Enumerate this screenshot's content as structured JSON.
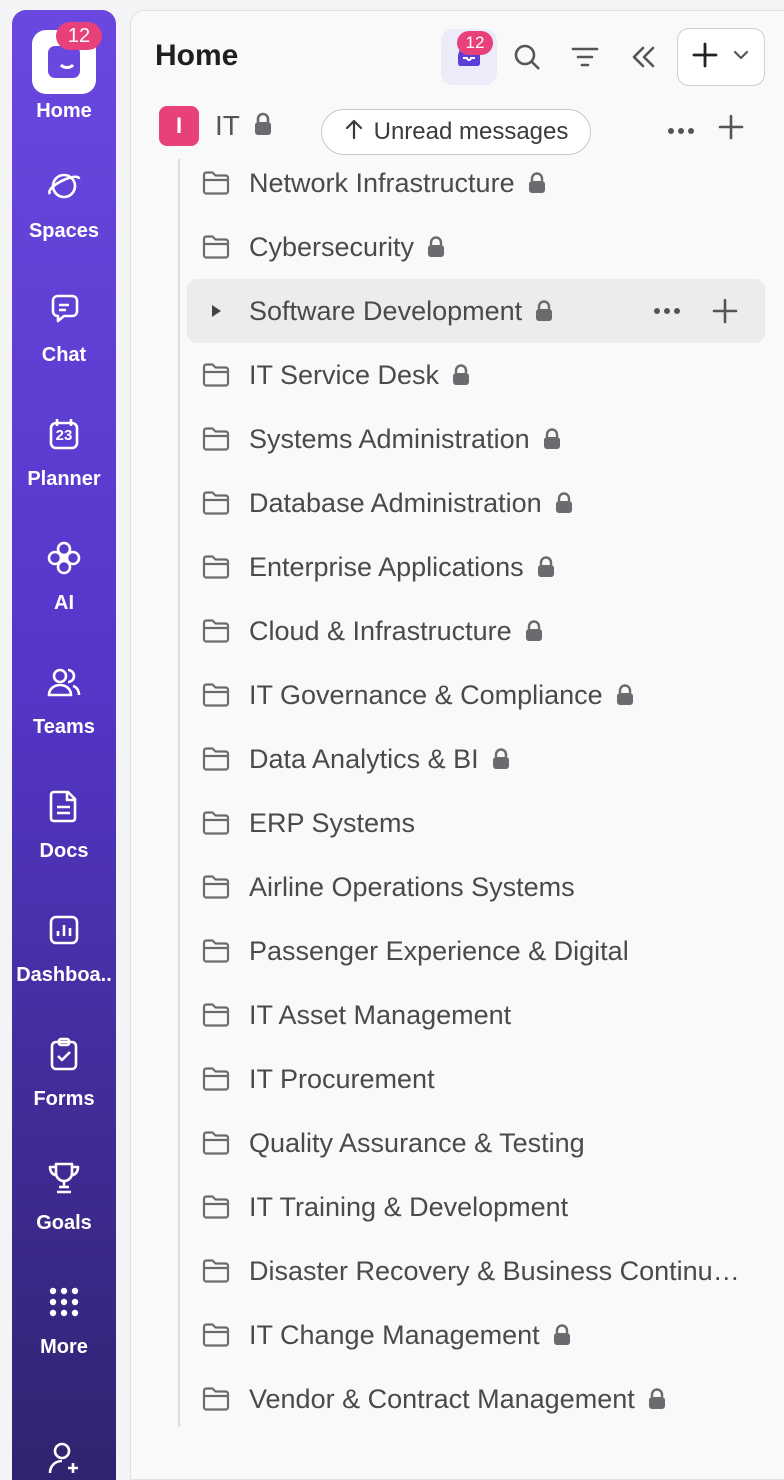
{
  "rail": {
    "badge_count": "12",
    "items": [
      {
        "label": "Home",
        "icon": "home-icon"
      },
      {
        "label": "Spaces",
        "icon": "planet-icon"
      },
      {
        "label": "Chat",
        "icon": "chat-icon"
      },
      {
        "label": "Planner",
        "icon": "calendar-icon"
      },
      {
        "label": "AI",
        "icon": "ai-sparkle-icon"
      },
      {
        "label": "Teams",
        "icon": "teams-icon"
      },
      {
        "label": "Docs",
        "icon": "document-icon"
      },
      {
        "label": "Dashboa..",
        "icon": "dashboard-icon"
      },
      {
        "label": "Forms",
        "icon": "form-clipboard-icon"
      },
      {
        "label": "Goals",
        "icon": "trophy-icon"
      },
      {
        "label": "More",
        "icon": "grid-dots-icon"
      }
    ],
    "calendar_day": "23"
  },
  "header": {
    "title": "Home",
    "inbox_badge": "12"
  },
  "space": {
    "avatar_letter": "I",
    "name": "IT",
    "unread_label": "Unread messages"
  },
  "folders": [
    {
      "name": "Network Infrastructure",
      "locked": true
    },
    {
      "name": "Cybersecurity",
      "locked": true
    },
    {
      "name": "Software Development",
      "locked": true,
      "active": true
    },
    {
      "name": "IT Service Desk",
      "locked": true
    },
    {
      "name": "Systems Administration",
      "locked": true
    },
    {
      "name": "Database Administration",
      "locked": true
    },
    {
      "name": "Enterprise Applications",
      "locked": true
    },
    {
      "name": "Cloud & Infrastructure",
      "locked": true
    },
    {
      "name": "IT Governance & Compliance",
      "locked": true
    },
    {
      "name": "Data Analytics & BI",
      "locked": true
    },
    {
      "name": "ERP Systems",
      "locked": false
    },
    {
      "name": "Airline Operations Systems",
      "locked": false
    },
    {
      "name": "Passenger Experience & Digital",
      "locked": false
    },
    {
      "name": "IT Asset Management",
      "locked": false
    },
    {
      "name": "IT Procurement",
      "locked": false
    },
    {
      "name": "Quality Assurance & Testing",
      "locked": false
    },
    {
      "name": "IT Training & Development",
      "locked": false
    },
    {
      "name": "Disaster Recovery & Business Continu…",
      "locked": false
    },
    {
      "name": "IT Change Management",
      "locked": true
    },
    {
      "name": "Vendor & Contract Management",
      "locked": true
    }
  ],
  "colors": {
    "rail_top": "#6a48e0",
    "rail_bottom": "#2f2470",
    "badge": "#e8407a",
    "space_avatar": "#e8407a"
  }
}
